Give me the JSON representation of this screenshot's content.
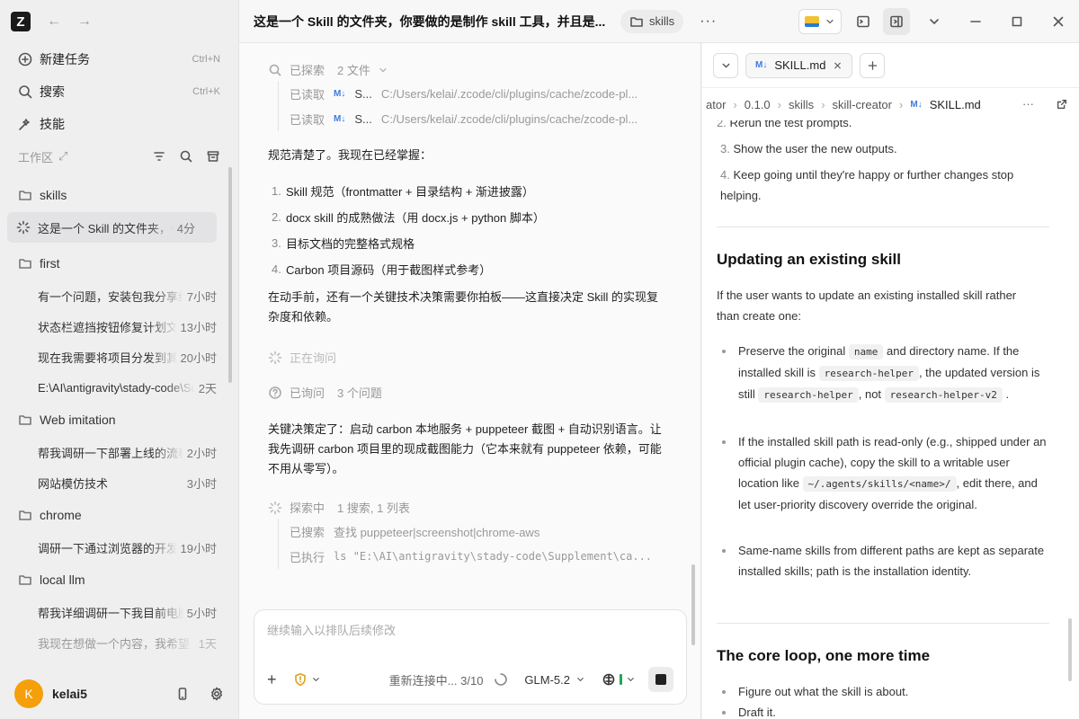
{
  "app": {
    "logo_letter": "Z"
  },
  "sidebar": {
    "menu": [
      {
        "label": "新建任务",
        "shortcut": "Ctrl+N",
        "icon": "plus-circle-icon"
      },
      {
        "label": "搜索",
        "shortcut": "Ctrl+K",
        "icon": "search-icon"
      },
      {
        "label": "技能",
        "shortcut": "",
        "icon": "skills-icon"
      }
    ],
    "workspace_label": "工作区",
    "folders": [
      {
        "name": "skills",
        "items": [
          {
            "title": "这是一个 Skill 的文件夹，你要做的是制作",
            "time": "4分",
            "active": true
          }
        ]
      },
      {
        "name": "first",
        "items": [
          {
            "title": "有一个问题，安装包我分享给别人",
            "time": "7小时"
          },
          {
            "title": "状态栏遮挡按钮修复计划文档",
            "time": "13小时"
          },
          {
            "title": "现在我需要将项目分发到其他电脑",
            "time": "20小时"
          },
          {
            "title": "E:\\AI\\antigravity\\stady-code\\Supplement",
            "time": "2天"
          }
        ]
      },
      {
        "name": "Web imitation",
        "items": [
          {
            "title": "帮我调研一下部署上线的流程",
            "time": "2小时"
          },
          {
            "title": "网站模仿技术",
            "time": "3小时"
          }
        ]
      },
      {
        "name": "chrome",
        "items": [
          {
            "title": "调研一下通过浏览器的开发者工具",
            "time": "19小时"
          }
        ]
      },
      {
        "name": "local llm",
        "items": [
          {
            "title": "帮我详细调研一下我目前电脑的配置",
            "time": "5小时"
          },
          {
            "title": "我现在想做一个内容，我希望",
            "time": "1天"
          }
        ]
      }
    ],
    "user": {
      "initial": "K",
      "name": "kelai5"
    }
  },
  "titlebar": {
    "title": "这是一个 Skill 的文件夹，你要做的是制作 skill 工具，并且是...",
    "chip": "skills",
    "more": "···"
  },
  "chat": {
    "explored": {
      "label": "已探索",
      "count": "2 文件"
    },
    "reads": [
      {
        "label": "已读取",
        "file": "S...",
        "path": "C:/Users/kelai/.zcode/cli/plugins/cache/zcode-pl..."
      },
      {
        "label": "已读取",
        "file": "S...",
        "path": "C:/Users/kelai/.zcode/cli/plugins/cache/zcode-pl..."
      }
    ],
    "p1": "规范清楚了。我现在已经掌握：",
    "list": [
      "Skill 规范（frontmatter + 目录结构 + 渐进披露）",
      "docx skill 的成熟做法（用 docx.js + python 脚本）",
      "目标文档的完整格式规格",
      "Carbon 项目源码（用于截图样式参考）"
    ],
    "p2": "在动手前，还有一个关键技术决策需要你拍板——这直接决定 Skill 的实现复杂度和依赖。",
    "asking": "正在询问",
    "asked": {
      "label": "已询问",
      "count": "3 个问题"
    },
    "p3": "关键决策定了：启动 carbon 本地服务 + puppeteer 截图 + 自动识别语言。让我先调研 carbon 项目里的现成截图能力（它本来就有 puppeteer 依赖，可能不用从零写）。",
    "exploring": {
      "label": "探索中",
      "count": "1 搜索, 1 列表"
    },
    "sub2": [
      {
        "label": "已搜索",
        "text": "查找 puppeteer|screenshot|chrome-aws"
      },
      {
        "label": "已执行",
        "text": "ls \"E:\\AI\\antigravity\\stady-code\\Supplement\\ca..."
      }
    ],
    "composer": {
      "placeholder": "继续输入以排队后续修改",
      "status": "重新连接中... 3/10",
      "model": "GLM-5.2"
    }
  },
  "doc": {
    "tab": "SKILL.md",
    "breadcrumbs": [
      "ator",
      "0.1.0",
      "skills",
      "skill-creator",
      "SKILL.md"
    ],
    "top_items": [
      {
        "n": "2.",
        "text": "Rerun the test prompts."
      },
      {
        "n": "3.",
        "text": "Show the user the new outputs."
      },
      {
        "n": "4.",
        "text": "Keep going until they're happy or further changes stop helping."
      }
    ],
    "h_update": "Updating an existing skill",
    "p_update": "If the user wants to update an existing installed skill rather than create one:",
    "b1": {
      "t1": "Preserve the original",
      "c1": "name",
      "t2": "and directory name. If the installed skill is",
      "c2": "research-helper",
      "t3": ", the updated version is still",
      "c3": "research-helper",
      "t4": ", not",
      "c4": "research-helper-v2",
      "t5": "."
    },
    "b2": {
      "t1": "If the installed skill path is read-only (e.g., shipped under an official plugin cache), copy the skill to a writable user location like",
      "c1": "~/.agents/skills/<name>/",
      "t2": ", edit there, and let user-priority discovery override the original."
    },
    "b3": "Same-name skills from different paths are kept as separate installed skills; path is the installation identity.",
    "h_loop": "The core loop, one more time",
    "loop": [
      "Figure out what the skill is about.",
      "Draft it."
    ]
  },
  "colors": {
    "accent": "#f59f0a",
    "md_icon": "#3d7be0"
  }
}
